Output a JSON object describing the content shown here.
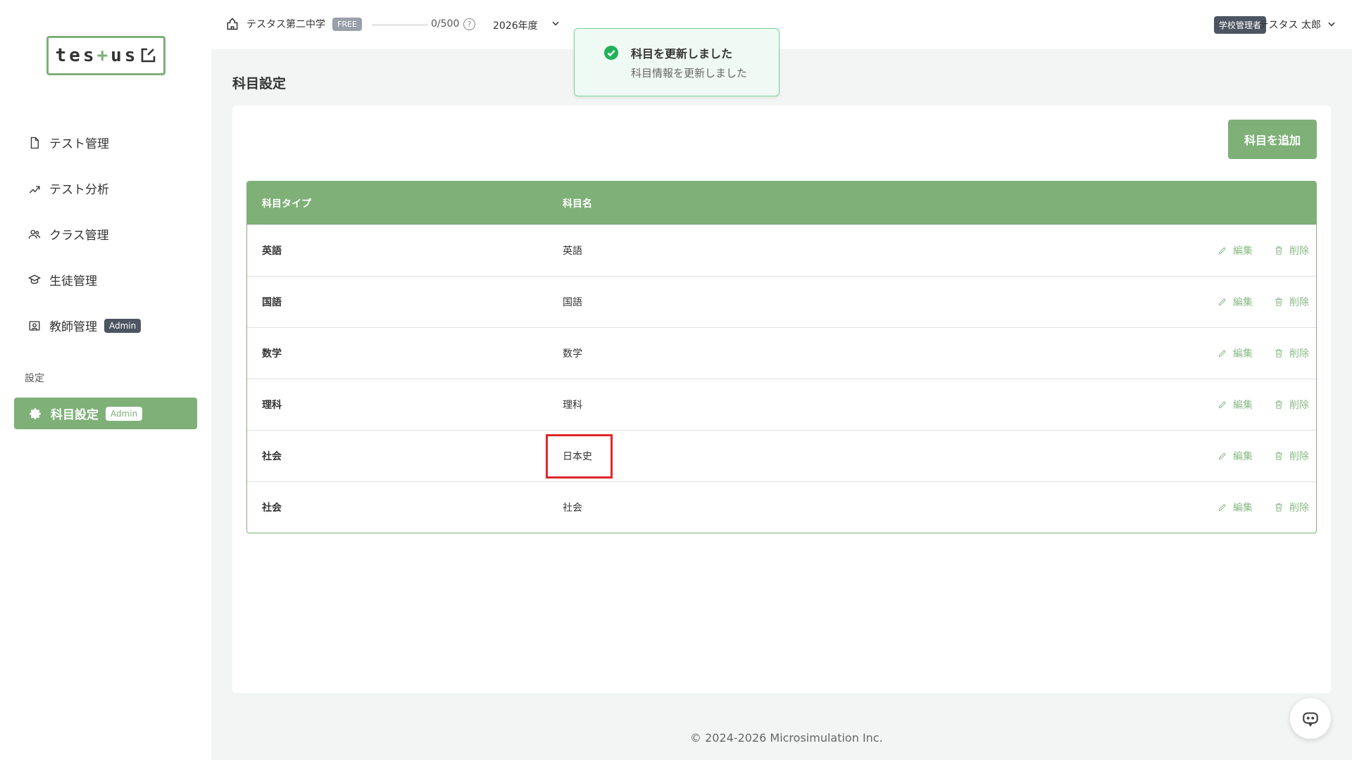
{
  "logo": {
    "left": "tes",
    "plus": "+",
    "right": "us"
  },
  "sidebar": {
    "items": [
      {
        "label": "テスト管理",
        "icon": "document-icon"
      },
      {
        "label": "テスト分析",
        "icon": "analysis-icon"
      },
      {
        "label": "クラス管理",
        "icon": "group-icon"
      },
      {
        "label": "生徒管理",
        "icon": "student-icon"
      },
      {
        "label": "教師管理",
        "icon": "teacher-icon",
        "badge": "Admin"
      }
    ],
    "section_label": "設定",
    "active_item": {
      "label": "科目設定",
      "icon": "gear-icon",
      "badge": "Admin"
    }
  },
  "header": {
    "school_name": "テスタス第二中学",
    "plan_badge": "FREE",
    "quota": "0/500",
    "quota_progress": 0,
    "help": "?",
    "year": "2026年度",
    "role_badge": "学校管理者",
    "user_name": "テスタス 太郎"
  },
  "toast": {
    "title": "科目を更新しました",
    "message": "科目情報を更新しました",
    "status_color": "#22b25a"
  },
  "page": {
    "title": "科目設定",
    "add_button": "科目を追加"
  },
  "table": {
    "headers": [
      "科目タイプ",
      "科目名"
    ],
    "edit_label": "編集",
    "delete_label": "削除",
    "rows": [
      {
        "type": "英語",
        "name": "英語"
      },
      {
        "type": "国語",
        "name": "国語"
      },
      {
        "type": "数学",
        "name": "数学"
      },
      {
        "type": "理科",
        "name": "理科"
      },
      {
        "type": "社会",
        "name": "日本史"
      },
      {
        "type": "社会",
        "name": "社会"
      }
    ]
  },
  "footer": {
    "copyright": "© 2024-2026 Microsimulation Inc."
  },
  "colors": {
    "accent": "#7eb078",
    "highlight": "#e0262b",
    "badge_dark": "#4d5562"
  }
}
